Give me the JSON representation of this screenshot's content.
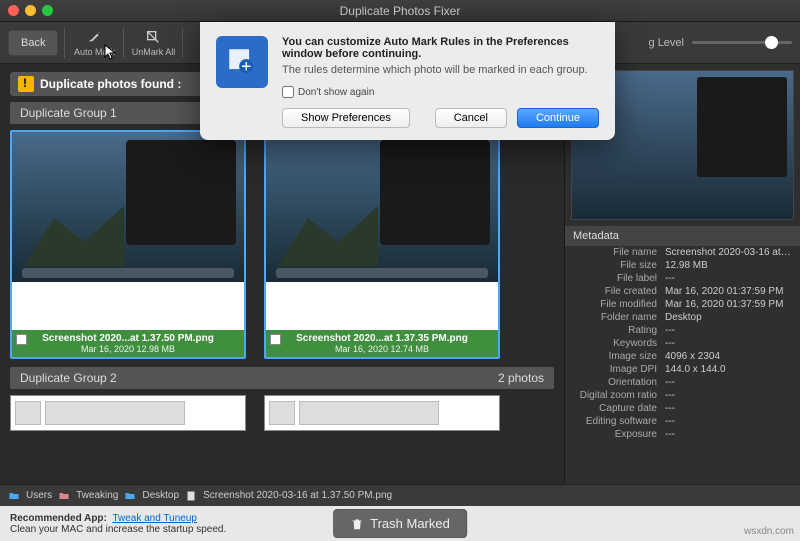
{
  "window": {
    "title": "Duplicate Photos Fixer"
  },
  "toolbar": {
    "back": "Back",
    "automark": "Auto Mark",
    "unmarkall": "UnMark All",
    "matching_level": "g Level"
  },
  "found": {
    "label": "Duplicate photos found :"
  },
  "group1": {
    "title": "Duplicate Group 1"
  },
  "card1": {
    "filename": "Screenshot 2020...at 1.37.50 PM.png",
    "meta": "Mar 16, 2020  12.98 MB"
  },
  "card2": {
    "filename": "Screenshot 2020...at 1.37.35 PM.png",
    "meta": "Mar 16, 2020  12.74 MB"
  },
  "group2": {
    "title": "Duplicate Group 2",
    "count": "2 photos"
  },
  "metadata_hdr": "Metadata",
  "meta": {
    "filename_k": "File name",
    "filename_v": "Screenshot 2020-03-16 at 1...",
    "filesize_k": "File size",
    "filesize_v": "12.98 MB",
    "filelabel_k": "File label",
    "filelabel_v": "---",
    "filecreated_k": "File created",
    "filecreated_v": "Mar 16, 2020 01:37:59 PM",
    "filemodified_k": "File modified",
    "filemodified_v": "Mar 16, 2020 01:37:59 PM",
    "folder_k": "Folder name",
    "folder_v": "Desktop",
    "rating_k": "Rating",
    "rating_v": "---",
    "keywords_k": "Keywords",
    "keywords_v": "---",
    "imagesize_k": "Image size",
    "imagesize_v": "4096 x 2304",
    "dpi_k": "Image DPI",
    "dpi_v": "144.0 x 144.0",
    "orient_k": "Orientation",
    "orient_v": "---",
    "zoom_k": "Digital zoom ratio",
    "zoom_v": "---",
    "capdate_k": "Capture date",
    "capdate_v": "---",
    "editsw_k": "Editing software",
    "editsw_v": "---",
    "exposure_k": "Exposure",
    "exposure_v": "---"
  },
  "breadcrumb": {
    "users": "Users",
    "tweaking": "Tweaking",
    "desktop": "Desktop",
    "file": "Screenshot 2020-03-16 at 1.37.50 PM.png"
  },
  "footer": {
    "rec": "Recommended App:",
    "link": "Tweak and Tuneup",
    "sub": "Clean your MAC and increase the startup speed.",
    "trash": "Trash Marked"
  },
  "modal": {
    "heading": "You can customize Auto Mark Rules in the Preferences window before continuing.",
    "sub": "The rules determine which photo will be marked in each group.",
    "dontshow": "Don't show again",
    "showprefs": "Show Preferences",
    "cancel": "Cancel",
    "continue": "Continue"
  },
  "watermark": "wsxdn.com"
}
